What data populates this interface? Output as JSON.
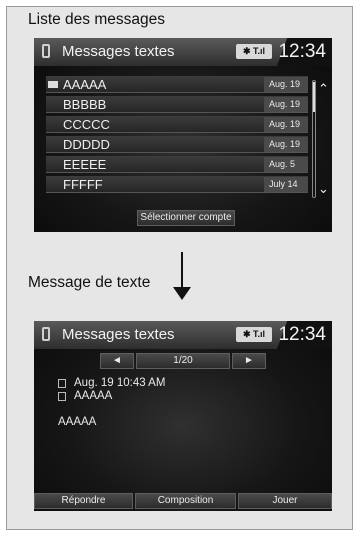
{
  "captions": {
    "list": "Liste des messages",
    "message": "Message de texte"
  },
  "list_screen": {
    "title": "Messages textes",
    "status": "༞ T.ıl",
    "time": "12:34",
    "messages": [
      {
        "sender": "AAAAA",
        "date": "Aug. 19",
        "unread": true
      },
      {
        "sender": "BBBBB",
        "date": "Aug. 19",
        "unread": false
      },
      {
        "sender": "CCCCC",
        "date": "Aug. 19",
        "unread": false
      },
      {
        "sender": "DDDDD",
        "date": "Aug. 19",
        "unread": false
      },
      {
        "sender": "EEEEE",
        "date": "Aug. 5",
        "unread": false
      },
      {
        "sender": "FFFFF",
        "date": "July 14",
        "unread": false
      }
    ],
    "select_account": "Sélectionner compte",
    "scroll_up": "⌃",
    "scroll_down": "⌄"
  },
  "message_screen": {
    "title": "Messages textes",
    "status": "༞ T.ıl",
    "time": "12:34",
    "prev": "◄",
    "next": "►",
    "page": "1/20",
    "datetime": "Aug. 19 10:43 AM",
    "sender": "AAAAA",
    "body": "AAAAA",
    "buttons": {
      "reply": "Répondre",
      "compose": "Composition",
      "play": "Jouer"
    }
  },
  "colors": {
    "screen_bg": "#161616",
    "frame_bg": "#e6e6e6",
    "text": "#f0f0f0"
  }
}
